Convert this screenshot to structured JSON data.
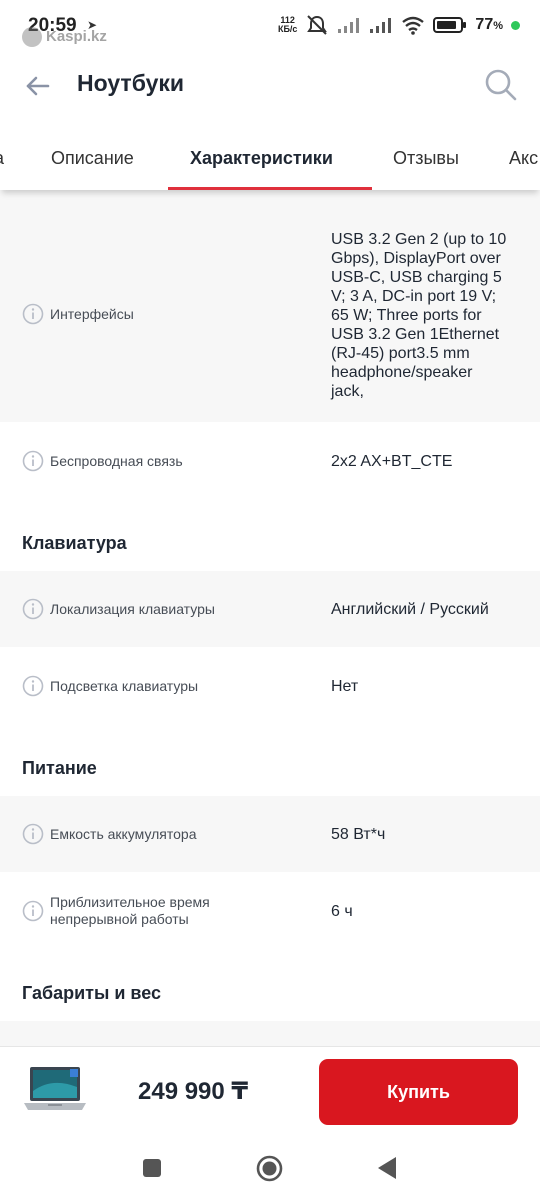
{
  "status_bar": {
    "time": "20:59",
    "watermark": "Kaspi.kz",
    "net_speed_value": "112",
    "net_speed_unit": "КБ/с",
    "battery_percent": "77",
    "battery_suffix": "%"
  },
  "header": {
    "title": "Ноутбуки"
  },
  "tabs": [
    {
      "label": "а"
    },
    {
      "label": "Описание"
    },
    {
      "label": "Характеристики"
    },
    {
      "label": "Отзывы"
    },
    {
      "label": "Акс"
    }
  ],
  "specs": {
    "interfaces": {
      "label": "Интерфейсы",
      "value_lines": [
        "USB 3.2 Gen 2 (up to 10",
        "Gbps), DisplayPort over",
        "USB-C, USB charging 5",
        "V; 3 A, DC-in port 19 V;",
        "65 W; Three ports for",
        "USB 3.2 Gen 1Ethernet",
        "(RJ-45) port3.5 mm",
        "headphone/speaker",
        "jack,"
      ]
    },
    "wireless": {
      "label": "Беспроводная связь",
      "value": "2x2 AX+BT_CTE"
    },
    "keyboard_section": "Клавиатура",
    "keyboard_layout": {
      "label": "Локализация клавиатуры",
      "value": "Английский / Русский"
    },
    "keyboard_backlight": {
      "label": "Подсветка клавиатуры",
      "value": "Нет"
    },
    "power_section": "Питание",
    "battery_capacity": {
      "label": "Емкость аккумулятора",
      "value": "58 Вт*ч"
    },
    "battery_life": {
      "label_lines": [
        "Приблизительное время",
        "непрерывной работы"
      ],
      "value": "6 ч"
    },
    "dimensions_section": "Габариты и вес"
  },
  "bottom_bar": {
    "price": "249 990 ₸",
    "buy_label": "Купить"
  },
  "colors": {
    "accent_red": "#d9171f",
    "tab_underline": "#e0303c",
    "text_dark": "#1f2733",
    "row_shade": "#f7f7f7"
  },
  "icons": [
    "back-arrow-icon",
    "search-icon",
    "info-icon",
    "square-nav-icon",
    "circle-nav-icon",
    "triangle-nav-icon"
  ]
}
